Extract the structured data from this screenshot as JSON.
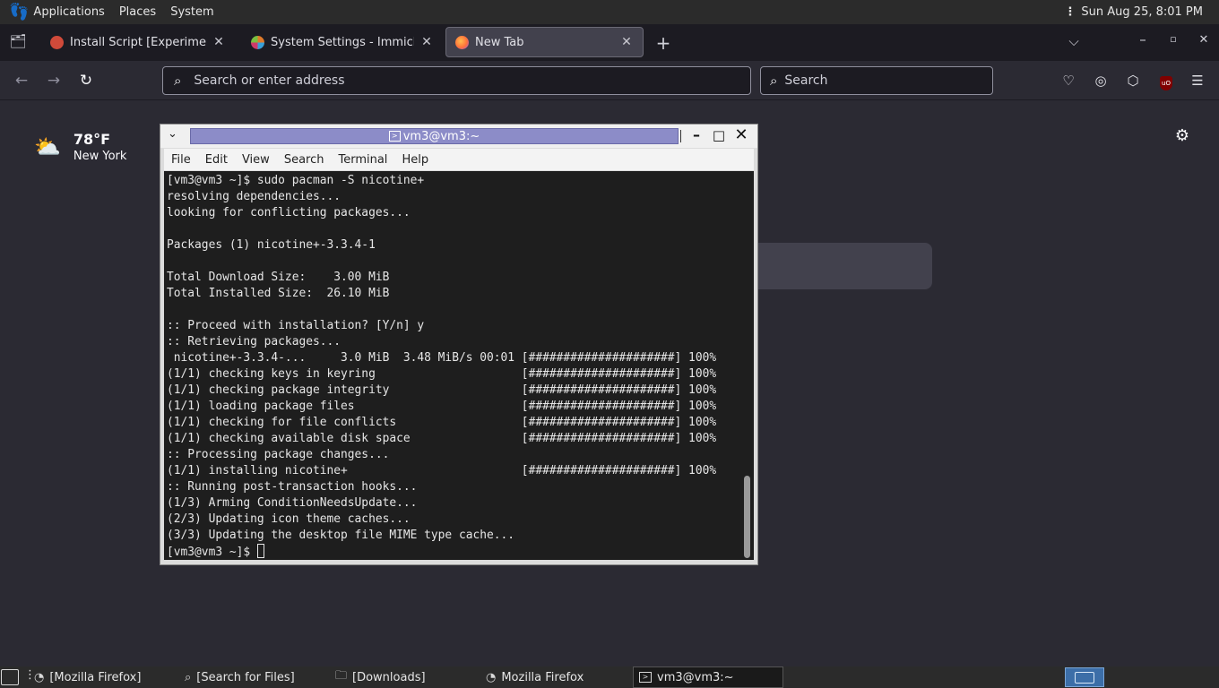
{
  "top_panel": {
    "menu": [
      "Applications",
      "Places",
      "System"
    ],
    "clock": "Sun Aug 25,  8:01 PM"
  },
  "tabs": [
    {
      "title": "Install Script [Experimental",
      "favicon_color": "#d04a3a",
      "active": false
    },
    {
      "title": "System Settings - Immich",
      "favicon_color": "#e07a2a",
      "active": false
    },
    {
      "title": "New Tab",
      "favicon_color": "#ff7139",
      "active": true
    }
  ],
  "address_bar": {
    "placeholder": "Search or enter address"
  },
  "search_bar": {
    "placeholder": "Search"
  },
  "weather": {
    "temperature": "78°F",
    "location": "New York"
  },
  "terminal": {
    "title": "vm3@vm3:~",
    "menu": [
      "File",
      "Edit",
      "View",
      "Search",
      "Terminal",
      "Help"
    ],
    "lines": [
      "[vm3@vm3 ~]$ sudo pacman -S nicotine+",
      "resolving dependencies...",
      "looking for conflicting packages...",
      "",
      "Packages (1) nicotine+-3.3.4-1",
      "",
      "Total Download Size:    3.00 MiB",
      "Total Installed Size:  26.10 MiB",
      "",
      ":: Proceed with installation? [Y/n] y",
      ":: Retrieving packages...",
      " nicotine+-3.3.4-...     3.0 MiB  3.48 MiB/s 00:01 [#####################] 100%",
      "(1/1) checking keys in keyring                     [#####################] 100%",
      "(1/1) checking package integrity                   [#####################] 100%",
      "(1/1) loading package files                        [#####################] 100%",
      "(1/1) checking for file conflicts                  [#####################] 100%",
      "(1/1) checking available disk space                [#####################] 100%",
      ":: Processing package changes...",
      "(1/1) installing nicotine+                         [#####################] 100%",
      ":: Running post-transaction hooks...",
      "(1/3) Arming ConditionNeedsUpdate...",
      "(2/3) Updating icon theme caches...",
      "(3/3) Updating the desktop file MIME type cache..."
    ],
    "prompt": "[vm3@vm3 ~]$ "
  },
  "taskbar": [
    {
      "label": "[Mozilla Firefox]",
      "icon": "firefox-icon"
    },
    {
      "label": "[Search for Files]",
      "icon": "search-files-icon"
    },
    {
      "label": "[Downloads]",
      "icon": "folder-icon"
    },
    {
      "label": "Mozilla Firefox",
      "icon": "firefox-icon"
    },
    {
      "label": "vm3@vm3:~",
      "icon": "terminal-icon"
    }
  ]
}
